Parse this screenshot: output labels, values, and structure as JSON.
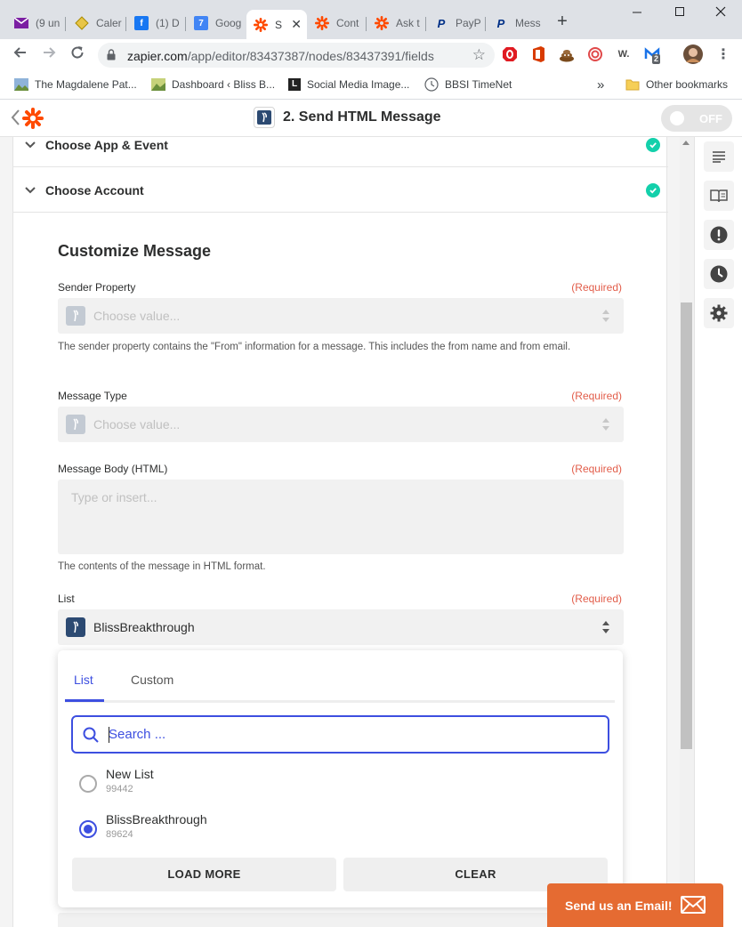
{
  "browser": {
    "tabs": [
      {
        "title": "(9 un",
        "icon": "gmail-icon",
        "color": "#7b1fa2"
      },
      {
        "title": "Caler",
        "icon": "calendar-icon",
        "color": "#c9a100"
      },
      {
        "title": "(1) D",
        "icon": "facebook-icon",
        "color": "#1877f2"
      },
      {
        "title": "Goog",
        "icon": "google-calendar-icon",
        "color": "#4285f4"
      },
      {
        "title": "S",
        "icon": "zapier-icon",
        "color": "#ff4a00",
        "active": true
      },
      {
        "title": "Cont",
        "icon": "zapier-icon",
        "color": "#ff4a00"
      },
      {
        "title": "Ask t",
        "icon": "zapier-icon",
        "color": "#ff4a00"
      },
      {
        "title": "PayP",
        "icon": "paypal-icon",
        "color": "#003087"
      },
      {
        "title": "Mess",
        "icon": "paypal-icon",
        "color": "#003087"
      }
    ],
    "tab_close": "✕",
    "new_tab": "+",
    "url_host": "zapier.com",
    "url_path": "/app/editor/83437387/nodes/83437391/fields",
    "ext_badge": "2",
    "bookmarks": [
      {
        "label": "The Magdalene Pat...",
        "icon": "landscape-icon"
      },
      {
        "label": "Dashboard ‹ Bliss B...",
        "icon": "landscape-icon"
      },
      {
        "label": "Social Media Image...",
        "icon": "l-logo-icon"
      },
      {
        "label": "BBSI TimeNet",
        "icon": "clock-icon"
      }
    ],
    "bookmarks_more": "»",
    "other_bookmarks": "Other bookmarks"
  },
  "header": {
    "step_title": "2. Send HTML Message",
    "toggle_label": "OFF"
  },
  "sections": {
    "app_event": "Choose App & Event",
    "account": "Choose Account"
  },
  "form": {
    "title": "Customize Message",
    "required": "(Required)",
    "sender_label": "Sender Property",
    "sender_placeholder": "Choose value...",
    "sender_help": "The sender property contains the \"From\" information for a message. This includes the from name and from email.",
    "type_label": "Message Type",
    "type_placeholder": "Choose value...",
    "body_label": "Message Body (HTML)",
    "body_placeholder": "Type or insert...",
    "body_help": "The contents of the message in HTML format.",
    "list_label": "List",
    "list_value": "BlissBreakthrough"
  },
  "dropdown": {
    "tab_list": "List",
    "tab_custom": "Custom",
    "search_placeholder": "Search ...",
    "options": [
      {
        "name": "New List",
        "id": "99442",
        "selected": false
      },
      {
        "name": "BlissBreakthrough",
        "id": "89624",
        "selected": true
      }
    ],
    "load_more": "LOAD MORE",
    "clear": "CLEAR"
  },
  "email_widget": {
    "label": "Send us an Email!"
  },
  "colors": {
    "zapier_orange": "#ff4a00",
    "accent_blue": "#3d4fe0",
    "success_green": "#13d0ab",
    "required_red": "#e25d4a",
    "email_orange": "#e56b32"
  }
}
